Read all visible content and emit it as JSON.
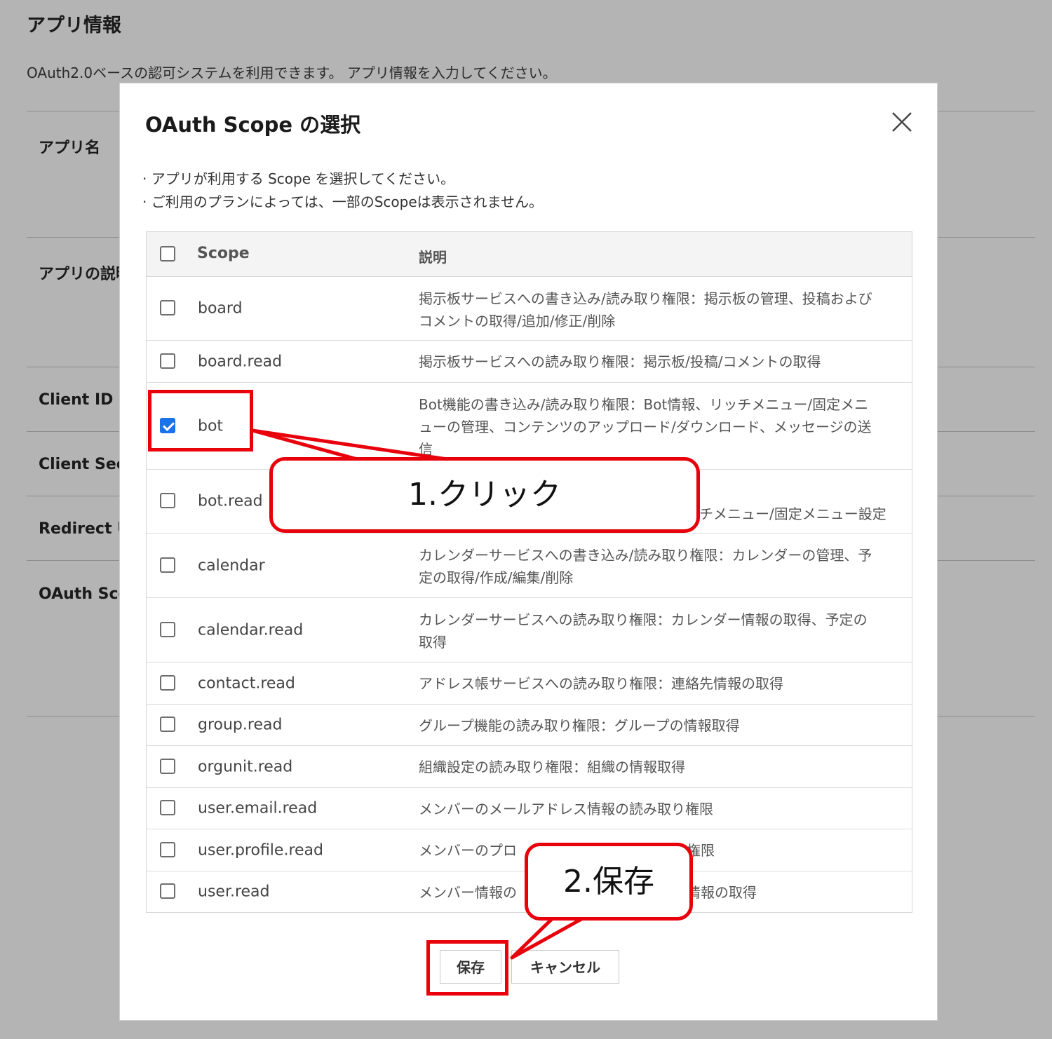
{
  "page": {
    "title": "アプリ情報",
    "description": "OAuth2.0ベースの認可システムを利用できます。 アプリ情報を入力してください。",
    "labels": [
      "アプリ名",
      "アプリの説明",
      "Client ID",
      "Client Secret",
      "Redirect URL",
      "OAuth Scope"
    ]
  },
  "modal": {
    "title": "OAuth Scope の選択",
    "notes": [
      "· アプリが利用する Scope を選択してください。",
      "· ご利用のプランによっては、一部のScopeは表示されません。"
    ],
    "table": {
      "col_scope": "Scope",
      "col_desc": "説明",
      "rows": [
        {
          "scope": "board",
          "desc": [
            "掲示板サービスへの書き込み/読み取り権限：掲示板の管理、投稿および",
            "コメントの取得/追加/修正/削除"
          ],
          "checked": false
        },
        {
          "scope": "board.read",
          "desc": [
            "掲示板サービスへの読み取り権限：掲示板/投稿/コメントの取得"
          ],
          "checked": false
        },
        {
          "scope": "bot",
          "desc": [
            "Bot機能の書き込み/読み取り権限：Bot情報、リッチメニュー/固定メニ",
            "ューの管理、コンテンツのアップロード/ダウンロード、メッセージの送",
            "信"
          ],
          "checked": true
        },
        {
          "scope": "bot.read",
          "desc": [
            "",
            "チメニュー/固定メニュー設定"
          ],
          "checked": false
        },
        {
          "scope": "calendar",
          "desc": [
            "カレンダーサービスへの書き込み/読み取り権限：カレンダーの管理、予",
            "定の取得/作成/編集/削除"
          ],
          "checked": false
        },
        {
          "scope": "calendar.read",
          "desc": [
            "カレンダーサービスへの読み取り権限：カレンダー情報の取得、予定の",
            "取得"
          ],
          "checked": false
        },
        {
          "scope": "contact.read",
          "desc": [
            "アドレス帳サービスへの読み取り権限：連絡先情報の取得"
          ],
          "checked": false
        },
        {
          "scope": "group.read",
          "desc": [
            "グループ機能の読み取り権限：グループの情報取得"
          ],
          "checked": false
        },
        {
          "scope": "orgunit.read",
          "desc": [
            "組織設定の読み取り権限：組織の情報取得"
          ],
          "checked": false
        },
        {
          "scope": "user.email.read",
          "desc": [
            "メンバーのメールアドレス情報の読み取り権限"
          ],
          "checked": false
        },
        {
          "scope": "user.profile.read",
          "desc": [
            "メンバーのプロ",
            "権限"
          ],
          "checked": false
        },
        {
          "scope": "user.read",
          "desc": [
            "メンバー情報の",
            "情報の取得"
          ],
          "checked": false
        }
      ]
    },
    "save_label": "保存",
    "cancel_label": "キャンセル"
  },
  "annotations": {
    "click_callout": "1.クリック",
    "save_callout": "2.保存",
    "color": "#e8000b"
  },
  "icons": {
    "close": "close-icon",
    "check": "checkmark-icon"
  }
}
